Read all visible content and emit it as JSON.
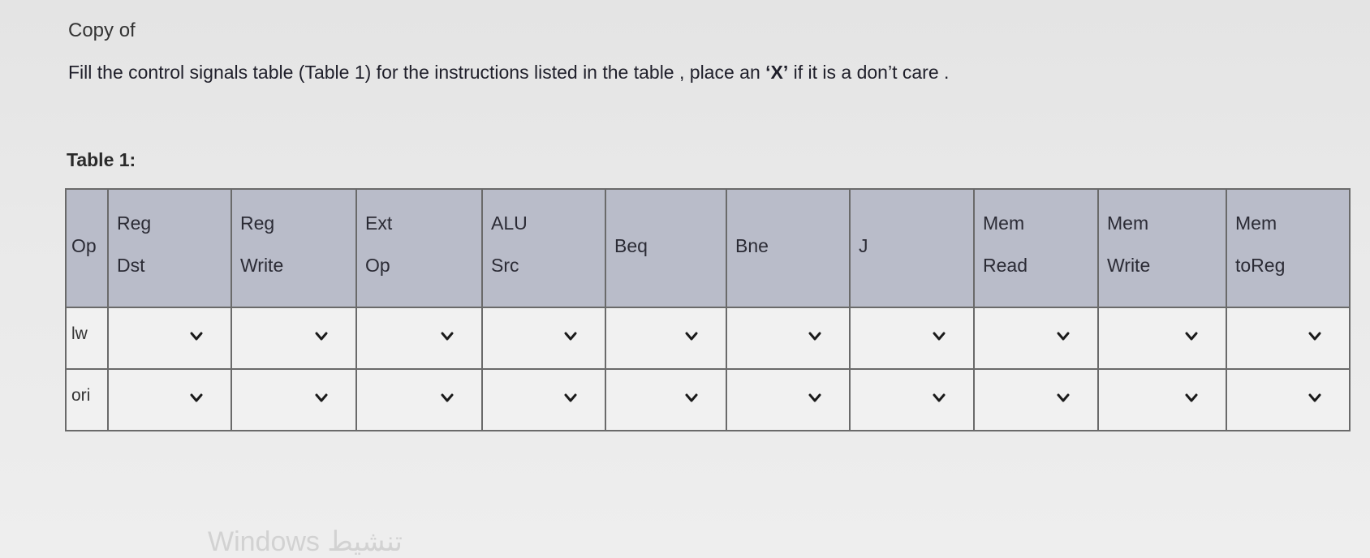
{
  "page": {
    "title": "Copy of",
    "instruction_prefix": "Fill the control signals table (Table 1)  for the instructions listed in the table , place an ",
    "instruction_x": "‘X’",
    "instruction_suffix": " if it is a don’t care .",
    "table_label": "Table 1:"
  },
  "table": {
    "op_header": "Op",
    "columns": [
      {
        "line1": "Reg",
        "line2": "Dst"
      },
      {
        "line1": "Reg",
        "line2": "Write"
      },
      {
        "line1": "Ext",
        "line2": "Op"
      },
      {
        "line1": "ALU",
        "line2": "Src"
      },
      {
        "single": "Beq"
      },
      {
        "single": "Bne"
      },
      {
        "single": "J"
      },
      {
        "line1": "Mem",
        "line2": "Read"
      },
      {
        "line1": "Mem",
        "line2": "Write"
      },
      {
        "line1": "Mem",
        "line2": "toReg"
      }
    ],
    "rows": [
      {
        "op": "lw"
      },
      {
        "op": "ori"
      }
    ]
  },
  "icons": {
    "dropdown_icon": "chevron-down-icon"
  },
  "colors": {
    "header_bg": "#b9bcc9",
    "cell_bg": "#f1f1f1",
    "border": "#6a6a6a"
  },
  "watermark": "Windows تنشيط"
}
